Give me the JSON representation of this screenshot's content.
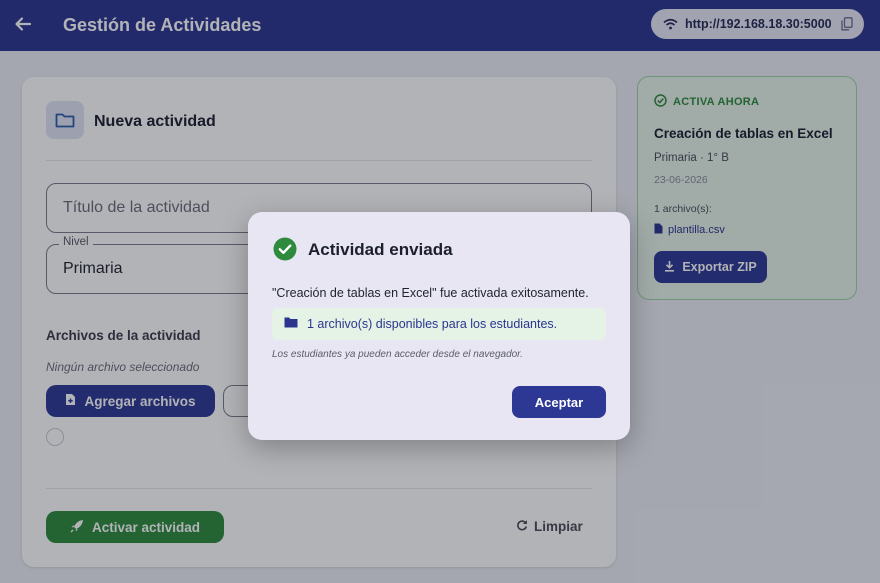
{
  "appbar": {
    "title": "Gestión de Actividades",
    "url": "http://192.168.18.30:5000",
    "back_icon": "arrow-left-icon",
    "wifi_icon": "wifi-icon",
    "copy_icon": "copy-icon",
    "color": "#2b3590"
  },
  "form": {
    "header_icon": "folder-icon",
    "title": "Nueva actividad",
    "title_placeholder": "Título de la actividad",
    "level_label": "Nivel",
    "level_value": "Primaria",
    "files_label": "Archivos de la actividad",
    "files_empty": "Ningún archivo seleccionado",
    "add_files_label": "Agregar archivos",
    "add_files_icon": "file-plus-icon",
    "activate_label": "Activar actividad",
    "activate_icon": "rocket-icon",
    "clear_label": "Limpiar",
    "clear_icon": "refresh-icon"
  },
  "active_card": {
    "badge": "ACTIVA AHORA",
    "badge_icon": "check-circle-icon",
    "title": "Creación de tablas en Excel",
    "meta": "Primaria · 1° B",
    "date": "23-06-2026",
    "files_count": "1 archivo(s):",
    "file_name": "plantilla.csv",
    "file_icon": "file-icon",
    "export_label": "Exportar ZIP",
    "export_icon": "download-icon",
    "accent": "#2e8a3c"
  },
  "dialog": {
    "title": "Actividad enviada",
    "icon": "check-circle-icon",
    "message": "\"Creación de tablas en Excel\" fue activada exitosamente.",
    "info": "1 archivo(s) disponibles para los estudiantes.",
    "info_icon": "folder-icon",
    "note": "Los estudiantes ya pueden acceder desde el navegador.",
    "ok_label": "Aceptar"
  }
}
